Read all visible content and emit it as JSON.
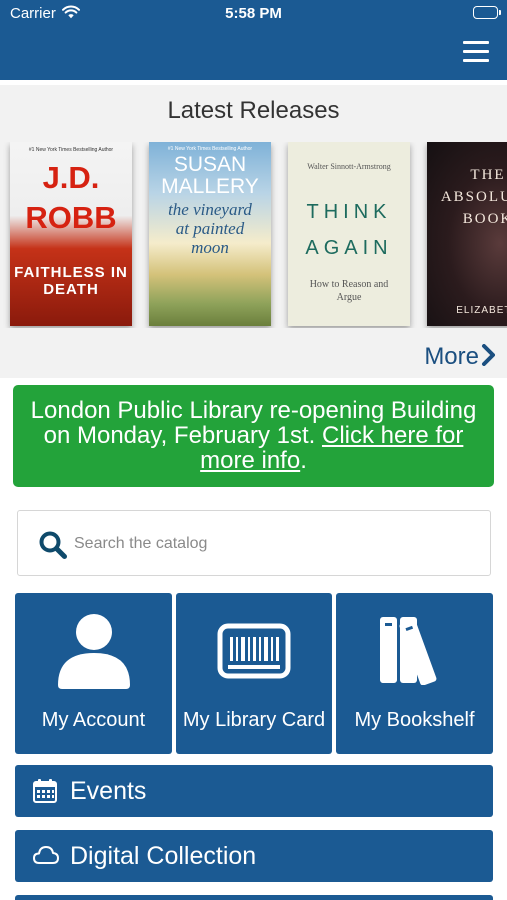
{
  "status_bar": {
    "carrier": "Carrier",
    "time": "5:58 PM"
  },
  "header": {
    "menu_icon": "hamburger-icon"
  },
  "releases": {
    "title": "Latest Releases",
    "more_label": "More",
    "books": [
      {
        "tagline": "#1 New York Times Bestselling Author",
        "author": "J.D. ROBB",
        "title": "FAITHLESS IN DEATH"
      },
      {
        "tagline": "#1 New York Times Bestselling Author",
        "author": "SUSAN MALLERY",
        "title": "the vineyard at painted moon"
      },
      {
        "tagline": "",
        "author": "Walter Sinnott-Armstrong",
        "title": "THINK AGAIN",
        "subtitle": "How to Reason and Argue"
      },
      {
        "tagline": "",
        "author": "ELIZABETH",
        "title": "THE ABSOLUTE BOOK"
      }
    ]
  },
  "banner": {
    "text": "London Public Library re-opening Building on Monday, February 1st. ",
    "link": "Click here for more info",
    "suffix": "."
  },
  "search": {
    "placeholder": "Search the catalog",
    "value": ""
  },
  "tiles": [
    {
      "label": "My Account",
      "icon": "user-icon"
    },
    {
      "label": "My Library Card",
      "icon": "barcode-card-icon"
    },
    {
      "label": "My Bookshelf",
      "icon": "books-icon"
    }
  ],
  "rows": [
    {
      "label": "Events",
      "icon": "calendar-icon"
    },
    {
      "label": "Digital Collection",
      "icon": "cloud-icon"
    }
  ],
  "colors": {
    "primary": "#1b5a93",
    "banner": "#23a33a",
    "more": "#1b4f80",
    "background": "#f2f2f2"
  }
}
